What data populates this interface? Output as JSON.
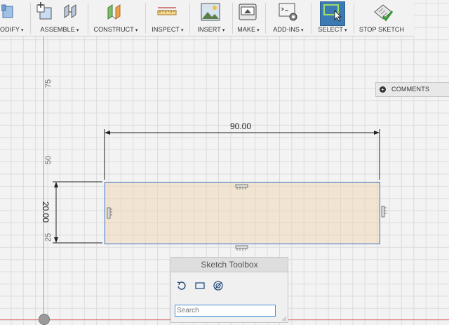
{
  "toolbar": {
    "groups": [
      {
        "label": "ODIFY",
        "icon": "modify-icon"
      },
      {
        "label": "ASSEMBLE",
        "icon": "assemble-icon"
      },
      {
        "label": "CONSTRUCT",
        "icon": "construct-icon"
      },
      {
        "label": "INSPECT",
        "icon": "inspect-icon"
      },
      {
        "label": "INSERT",
        "icon": "insert-icon"
      },
      {
        "label": "MAKE",
        "icon": "make-icon"
      },
      {
        "label": "ADD-INS",
        "icon": "add-ins-icon"
      },
      {
        "label": "SELECT",
        "icon": "select-icon"
      },
      {
        "label": "STOP SKETCH",
        "icon": "stop-sketch-icon"
      }
    ],
    "caret": "▾"
  },
  "ruler": {
    "marks": [
      "75",
      "50",
      "25"
    ]
  },
  "comments": {
    "label": "COMMENTS",
    "plus": "+"
  },
  "dimensions": {
    "width": "90.00",
    "height": "20.00"
  },
  "sketch_toolbox": {
    "title": "Sketch Toolbox",
    "tools": [
      "rotate-icon",
      "rectangle-icon",
      "target-icon"
    ],
    "search_placeholder": "Search"
  },
  "colors": {
    "select_active": "#3b7ab3",
    "sketch_line": "#3a6fbf",
    "y_axis": "#6fbf6f",
    "x_axis": "#e07070"
  }
}
